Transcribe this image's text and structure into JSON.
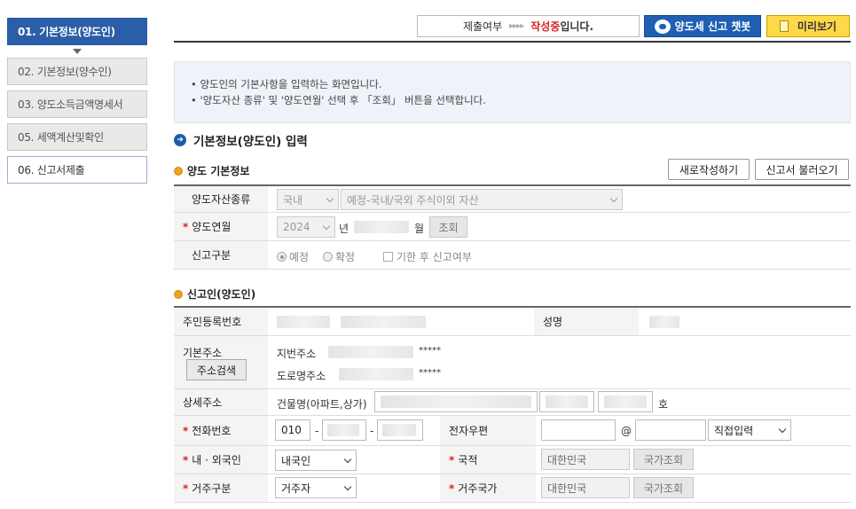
{
  "sidebar": {
    "steps": [
      {
        "label": "01. 기본정보(양도인)"
      },
      {
        "label": "02. 기본정보(양수인)"
      },
      {
        "label": "03. 양도소득금액명세서"
      },
      {
        "label": "05. 세액계산및확인"
      },
      {
        "label": "06. 신고서제출"
      }
    ]
  },
  "topbar": {
    "status_label": "제출여부",
    "status_arrows": "▸▸▸▸",
    "status_value": "작성중",
    "status_suffix": "입니다.",
    "chatbot_button": "양도세 신고 챗봇",
    "preview_button": "미리보기"
  },
  "info": {
    "line1": "• 양도인의 기본사항을 입력하는 화면입니다.",
    "line2": "• '양도자산 종류' 및 '양도연월' 선택 후 「조회」 버튼을 선택합니다."
  },
  "section": {
    "title": "기본정보(양도인) 입력",
    "basic_title": "양도 기본정보",
    "new_button": "새로작성하기",
    "load_button": "신고서 불러오기",
    "asset_type_label": "양도자산종류",
    "asset_domestic": "국내",
    "asset_kind": "예정-국내/국외 주식이외 자산",
    "transfer_month_label": "양도연월",
    "year_value": "2024",
    "year_unit": "년",
    "month_unit": "월",
    "lookup_button": "조회",
    "report_type_label": "신고구분",
    "radio_scheduled": "예정",
    "radio_confirmed": "확정",
    "late_check": "기한 후 신고여부"
  },
  "reporter": {
    "title": "신고인(양도인)",
    "rrn_label": "주민등록번호",
    "name_label": "성명",
    "address_label": "기본주소",
    "address_search_button": "주소검색",
    "lot_address_label": "지번주소",
    "road_address_label": "도로명주소",
    "masked": "*****",
    "detail_address_label": "상세주소",
    "building_label": "건물명(아파트,상가)",
    "unit_suffix": "호",
    "phone_label": "전화번호",
    "phone_prefix": "010",
    "dash": "-",
    "email_label": "전자우편",
    "at": "@",
    "email_domain_select": "직접입력",
    "national_label": "내 · 외국인",
    "national_value": "내국인",
    "nationality_label": "국적",
    "nationality_value": "대한민국",
    "country_lookup_button": "국가조회",
    "residence_label": "거주구분",
    "residence_value": "거주자",
    "residence_country_label": "거주국가",
    "residence_country_value": "대한민국"
  }
}
